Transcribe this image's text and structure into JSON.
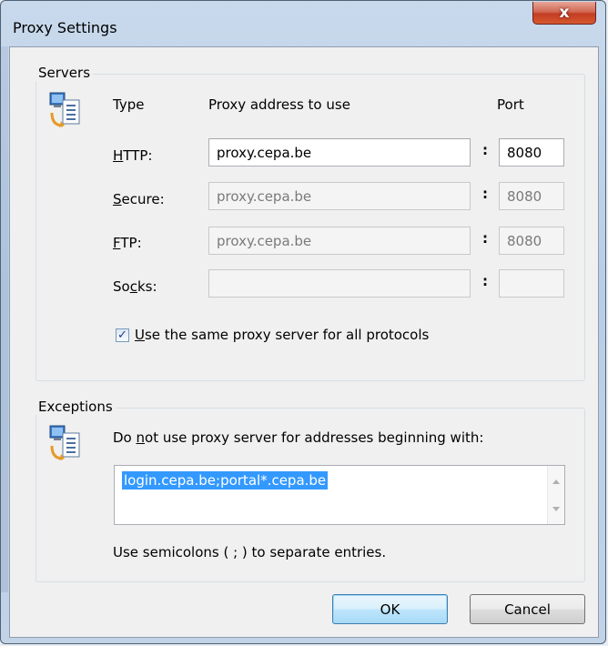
{
  "window": {
    "title": "Proxy Settings",
    "close_glyph": "x"
  },
  "servers": {
    "legend": "Servers",
    "icon": "network-computer-icon",
    "col_type": "Type",
    "col_address": "Proxy address to use",
    "col_port": "Port",
    "rows": [
      {
        "label_pre": "",
        "label_u": "H",
        "label_post": "TTP:",
        "address": "proxy.cepa.be",
        "port": "8080",
        "enabled": true
      },
      {
        "label_pre": "",
        "label_u": "S",
        "label_post": "ecure:",
        "address": "proxy.cepa.be",
        "port": "8080",
        "enabled": false
      },
      {
        "label_pre": "",
        "label_u": "F",
        "label_post": "TP:",
        "address": "proxy.cepa.be",
        "port": "8080",
        "enabled": false
      },
      {
        "label_pre": "So",
        "label_u": "c",
        "label_post": "ks:",
        "address": "",
        "port": "",
        "enabled": false
      }
    ],
    "colon": ":",
    "same_proxy": {
      "checked": true,
      "check_glyph": "✓",
      "label_u": "U",
      "label_post": "se the same proxy server for all protocols"
    }
  },
  "exceptions": {
    "legend": "Exceptions",
    "icon": "network-computer-icon",
    "prompt_pre": "Do ",
    "prompt_u": "n",
    "prompt_post": "ot use proxy server for addresses beginning with:",
    "value": "login.cepa.be;portal*.cepa.be",
    "hint": "Use semicolons ( ; ) to separate entries."
  },
  "buttons": {
    "ok": "OK",
    "cancel": "Cancel"
  },
  "colors": {
    "selection": "#3399ff",
    "close": "#c33d23",
    "default_button": "#3c7fb1"
  }
}
